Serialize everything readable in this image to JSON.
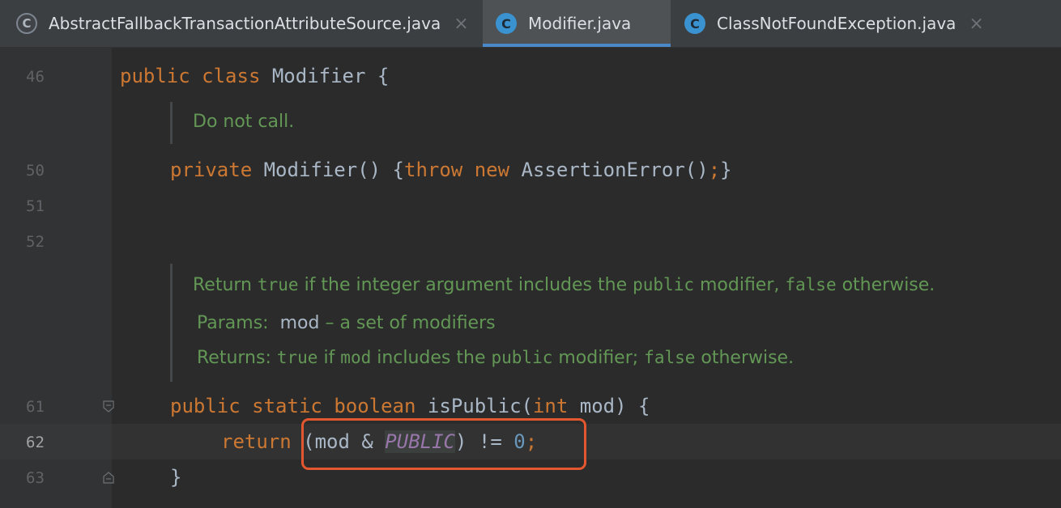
{
  "tabs": [
    {
      "icon": "class-file-icon",
      "letter": "C",
      "name": "AbstractFallbackTransactionAttributeSource.java",
      "close": "×",
      "active": false
    },
    {
      "icon": "class-file-icon",
      "letter": "C",
      "name": "Modifier.java",
      "close": "",
      "active": true
    },
    {
      "icon": "class-file-icon",
      "letter": "C",
      "name": "ClassNotFoundException.java",
      "close": "×",
      "active": false
    }
  ],
  "gutter": {
    "line_numbers": [
      "46",
      "50",
      "51",
      "52",
      "61",
      "62",
      "63"
    ],
    "current_line": "62"
  },
  "code": {
    "class_decl": {
      "kw1": "public",
      "kw2": "class",
      "name": "Modifier",
      "brace": "{"
    },
    "doc1": "Do not call.",
    "ctor": {
      "kw": "private",
      "sig": "Modifier() {",
      "throw": "throw",
      "new": "new",
      "rest": "AssertionError()",
      "semi": ";",
      "close": "}"
    },
    "doc2": {
      "line1": {
        "a": "Return ",
        "b": "true",
        "c": " if the integer argument includes the ",
        "d": "public",
        "e": " modifier, ",
        "f": "false",
        "g": " otherwise."
      },
      "params": {
        "label": "Params:",
        "name": "mod",
        "desc": " – a set of modifiers"
      },
      "returns": {
        "label": "Returns: ",
        "b": "true",
        "c": " if ",
        "d": "mod",
        "e": " includes the ",
        "f": "public",
        "g": " modifier; ",
        "h": "false",
        "i": " otherwise."
      }
    },
    "method": {
      "kw1": "public",
      "kw2": "static",
      "kw3": "boolean",
      "name": "isPublic(",
      "kw4": "int",
      "rest": " mod) {"
    },
    "ret": {
      "kw": "return",
      "a": " (mod & ",
      "const": "PUBLIC",
      "b": ") != ",
      "num": "0",
      "semi": ";"
    },
    "close": "}"
  },
  "colors": {
    "keyword": "#cc7832",
    "doc": "#629755",
    "number": "#6897bb",
    "constant": "#9876aa",
    "annotation_box": "#e4572e",
    "tab_underline": "#4a88c7"
  }
}
